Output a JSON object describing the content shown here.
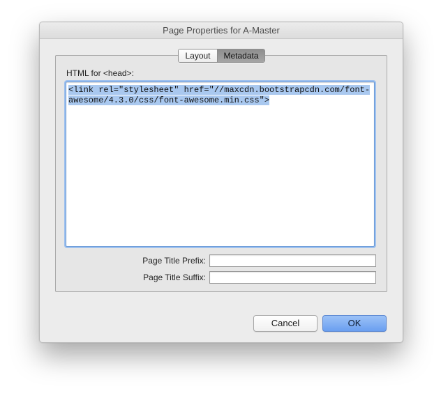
{
  "window": {
    "title": "Page Properties for A-Master"
  },
  "tabs": [
    {
      "label": "Layout",
      "selected": false
    },
    {
      "label": "Metadata",
      "selected": true
    }
  ],
  "head_html": {
    "label": "HTML for <head>:",
    "value": "<link rel=\"stylesheet\" href=\"//maxcdn.bootstrapcdn.com/font-awesome/4.3.0/css/font-awesome.min.css\">"
  },
  "fields": {
    "title_prefix": {
      "label": "Page Title Prefix:",
      "value": ""
    },
    "title_suffix": {
      "label": "Page Title Suffix:",
      "value": ""
    }
  },
  "buttons": {
    "cancel": "Cancel",
    "ok": "OK"
  },
  "colors": {
    "accent": "#6a9ff0",
    "selection": "#a9c8ef"
  }
}
